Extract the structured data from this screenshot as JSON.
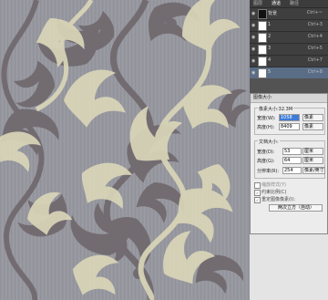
{
  "layers_panel": {
    "tabs": [
      "图层",
      "通道",
      "路径"
    ],
    "layers": [
      {
        "name": "背景",
        "shortcut": "Ctrl+~",
        "dark": true,
        "selected": false
      },
      {
        "name": "1",
        "shortcut": "Ctrl+3",
        "dark": false,
        "selected": false
      },
      {
        "name": "2",
        "shortcut": "Ctrl+4",
        "dark": false,
        "selected": false
      },
      {
        "name": "3",
        "shortcut": "Ctrl+5",
        "dark": false,
        "selected": false
      },
      {
        "name": "4",
        "shortcut": "Ctrl+7",
        "dark": false,
        "selected": false
      },
      {
        "name": "5",
        "shortcut": "Ctrl+8",
        "dark": false,
        "selected": true
      }
    ]
  },
  "dialog": {
    "title": "图像大小",
    "pixel_group": {
      "legend": "像素大小:32.3M",
      "width_label": "宽度(W):",
      "width_value": "1058",
      "width_unit": "像素",
      "height_label": "高度(H):",
      "height_value": "8409",
      "height_unit": "像素"
    },
    "doc_group": {
      "legend": "文档大小:",
      "width_label": "宽度(D):",
      "width_value": "53",
      "width_unit": "厘米",
      "height_label": "高度(G):",
      "height_value": "64",
      "height_unit": "厘米",
      "res_label": "分辨率(R):",
      "res_value": "254",
      "res_unit": "像素/英寸"
    },
    "checkboxes": [
      {
        "label": "缩放样式(Y)",
        "checked": false
      },
      {
        "label": "约束比例(C)",
        "checked": true
      },
      {
        "label": "重定图像像素(I):",
        "checked": true
      }
    ],
    "resample": "两次立方（自动）"
  },
  "colors": {
    "canvas_bg": "#9a9aa2",
    "scroll_dark": "#716a6f",
    "scroll_light": "#d9d6b8",
    "panel_bg": "#535353",
    "selected_layer": "#596d87",
    "dialog_bg": "#ececec"
  }
}
